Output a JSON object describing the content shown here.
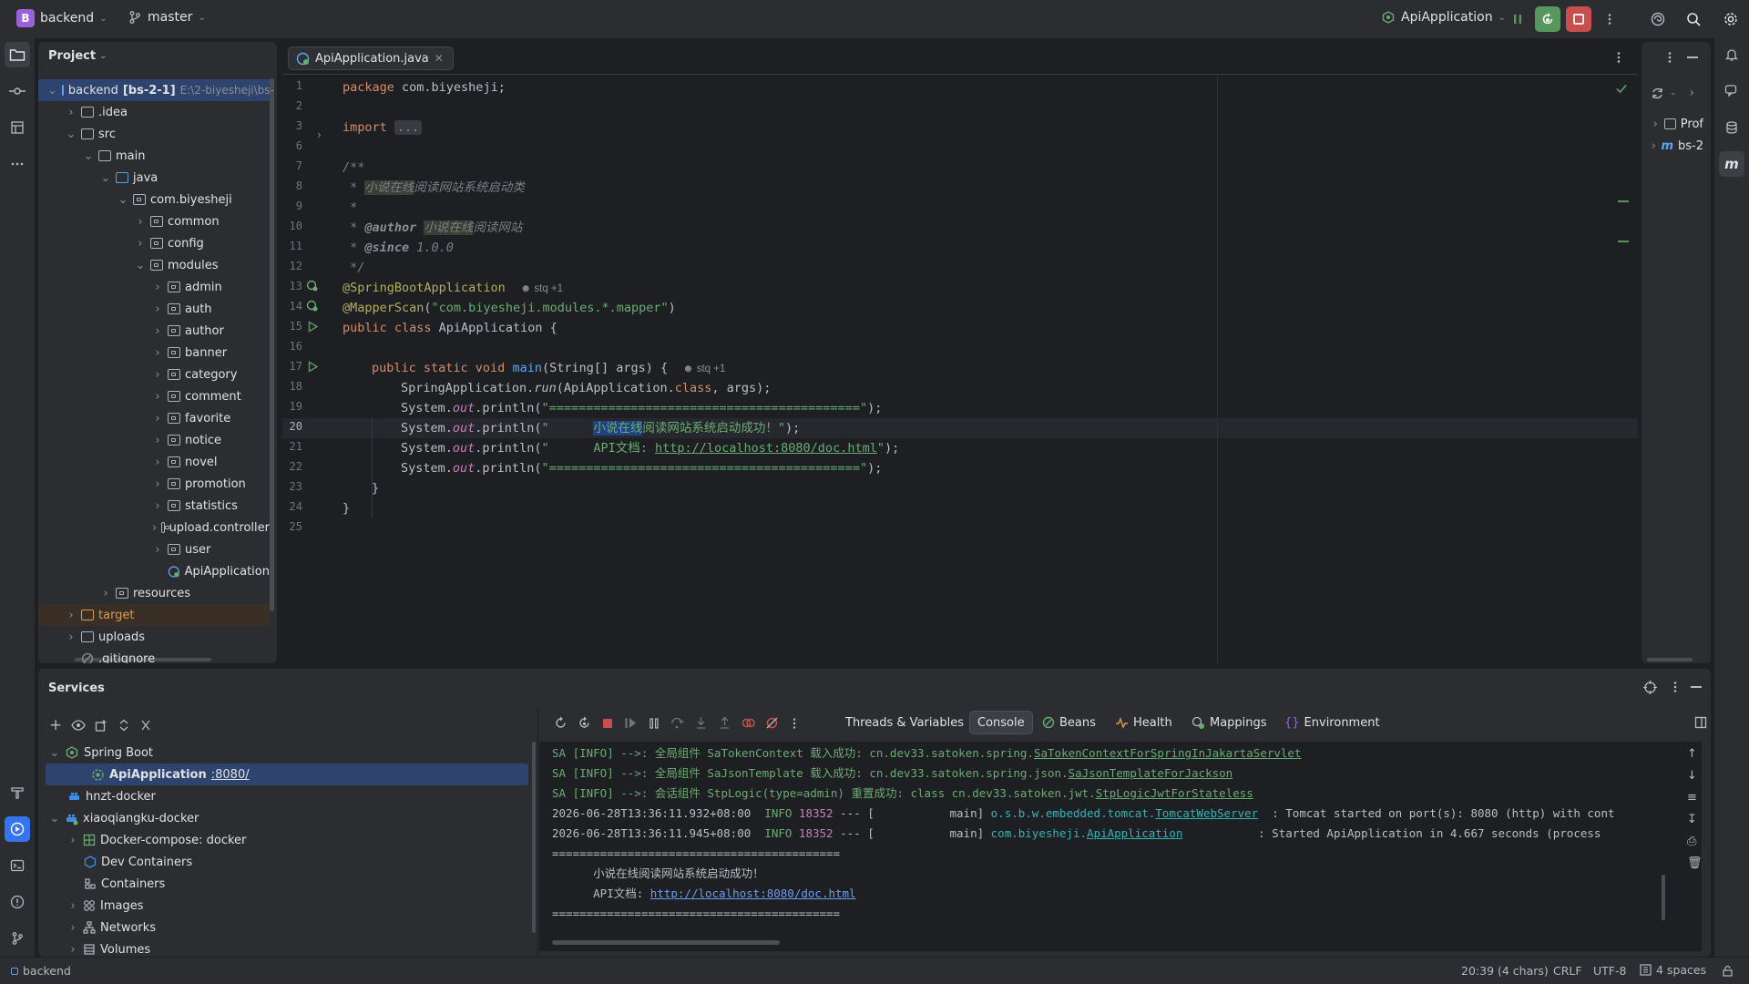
{
  "titlebar": {
    "project_letter": "B",
    "project_name": "backend",
    "branch": "master",
    "run_config": "ApiApplication"
  },
  "project_panel": {
    "title": "Project",
    "root_name": "backend",
    "root_module": "[bs-2-1]",
    "root_path": "E:\\2-biyesheji\\bs-",
    "items": [
      {
        "label": "backend"
      },
      {
        "label": ".idea"
      },
      {
        "label": "src"
      },
      {
        "label": "main"
      },
      {
        "label": "java"
      },
      {
        "label": "com.biyesheji"
      },
      {
        "label": "common"
      },
      {
        "label": "config"
      },
      {
        "label": "modules"
      },
      {
        "label": "admin"
      },
      {
        "label": "auth"
      },
      {
        "label": "author"
      },
      {
        "label": "banner"
      },
      {
        "label": "category"
      },
      {
        "label": "comment"
      },
      {
        "label": "favorite"
      },
      {
        "label": "notice"
      },
      {
        "label": "novel"
      },
      {
        "label": "promotion"
      },
      {
        "label": "statistics"
      },
      {
        "label": "upload.controller"
      },
      {
        "label": "user"
      },
      {
        "label": "ApiApplication"
      },
      {
        "label": "resources"
      },
      {
        "label": "target"
      },
      {
        "label": "uploads"
      },
      {
        "label": ".gitignore"
      }
    ]
  },
  "editor": {
    "tab_label": "ApiApplication.java",
    "line_numbers": [
      "1",
      "2",
      "3",
      "6",
      "7",
      "8",
      "9",
      "10",
      "11",
      "12",
      "13",
      "14",
      "15",
      "16",
      "17",
      "18",
      "19",
      "20",
      "21",
      "22",
      "23",
      "24",
      "25"
    ],
    "code": {
      "l1_kw": "package",
      "l1_rest": " com.biyesheji;",
      "l3_kw": "import",
      "l3_fold": "...",
      "l7": "/**",
      "l8_star": " * ",
      "l8_hl": "小说在线",
      "l8_rest": "阅读网站系统启动类",
      "l9": " *",
      "l10_star": " * ",
      "l10_tag": "@author",
      "l10_hl": "小说在线",
      "l10_rest": "阅读网站",
      "l11_star": " * ",
      "l11_tag": "@since",
      "l11_rest": " 1.0.0",
      "l12": " */",
      "l13_ann": "@SpringBootApplication",
      "l13_inlay": "stq +1",
      "l14_ann": "@MapperScan",
      "l14_open": "(",
      "l14_str": "\"com.biyesheji.modules.*.mapper\"",
      "l14_close": ")",
      "l15_kw": "public class",
      "l15_rest": " ApiApplication {",
      "l17_kw": "public static void",
      "l17_fn": "main",
      "l17_rest": "(String[] args) {",
      "l17_inlay": "stq +1",
      "l18_a": "SpringApplication.",
      "l18_it": "run",
      "l18_b": "(ApiApplication.",
      "l18_kw": "class",
      "l18_c": ", args);",
      "l19_a": "System.",
      "l19_it": "out",
      "l19_b": ".println(",
      "l19_str": "\"==========================================\"",
      "l19_c": ");",
      "l20_a": "System.",
      "l20_it": "out",
      "l20_b": ".println(",
      "l20_str1": "\"      ",
      "l20_sel": "小说在线",
      "l20_str2": "阅读网站系统启动成功！\"",
      "l20_c": ");",
      "l21_a": "System.",
      "l21_it": "out",
      "l21_b": ".println(",
      "l21_str1": "\"      API文档: ",
      "l21_link": "http://localhost:8080/doc.html",
      "l21_str2": "\"",
      "l21_c": ");",
      "l22_a": "System.",
      "l22_it": "out",
      "l22_b": ".println(",
      "l22_str": "\"==========================================\"",
      "l22_c": ");",
      "l23": "}",
      "l24": "}"
    }
  },
  "structure_panel": {
    "items": [
      {
        "label": "Prof"
      },
      {
        "label": "bs-2"
      }
    ]
  },
  "services": {
    "title": "Services",
    "tree": [
      {
        "label": "Spring Boot"
      },
      {
        "label": "ApiApplication",
        "port": ":8080/"
      },
      {
        "label": "hnzt-docker"
      },
      {
        "label": "xiaoqiangku-docker"
      },
      {
        "label": "Docker-compose: docker"
      },
      {
        "label": "Dev Containers"
      },
      {
        "label": "Containers"
      },
      {
        "label": "Images"
      },
      {
        "label": "Networks"
      },
      {
        "label": "Volumes"
      }
    ],
    "tabs": [
      {
        "label": "Threads & Variables"
      },
      {
        "label": "Console"
      },
      {
        "label": "Beans"
      },
      {
        "label": "Health"
      },
      {
        "label": "Mappings"
      },
      {
        "label": "Environment"
      }
    ],
    "console": {
      "c1_a": "SA [INFO] -->: 全局组件 SaTokenContext 载入成功: cn.dev33.satoken.spring.",
      "c1_u": "SaTokenContextForSpringInJakartaServlet",
      "c2_a": "SA [INFO] -->: 全局组件 SaJsonTemplate 载入成功: cn.dev33.satoken.spring.json.",
      "c2_u": "SaJsonTemplateForJackson",
      "c3_a": "SA [INFO] -->: 会话组件 StpLogic(type=admin) 重置成功: class cn.dev33.satoken.jwt.",
      "c3_u": "StpLogicJwtForStateless",
      "c4_a": "2026-06-28T13:36:11.932+08:00  ",
      "c4_info": "INFO",
      "c4_pid": " 18352",
      "c4_b": " --- [           main] ",
      "c4_cls": "o.s.b.w.embedded.tomcat.",
      "c4_u": "TomcatWebServer",
      "c4_msg": "  : Tomcat started on port(s): 8080 (http) with cont",
      "c5_a": "2026-06-28T13:36:11.945+08:00  ",
      "c5_info": "INFO",
      "c5_pid": " 18352",
      "c5_b": " --- [           main] ",
      "c5_cls": "com.biyesheji.",
      "c5_u": "ApiApplication",
      "c5_msg": "           : Started ApiApplication in 4.667 seconds (process",
      "c6": "==========================================",
      "c7": "      小说在线阅读网站系统启动成功！",
      "c8_a": "      API文档: ",
      "c8_link": "http://localhost:8080/doc.html",
      "c9": "=========================================="
    }
  },
  "statusbar": {
    "module": "backend",
    "position": "20:39 (4 chars)",
    "line_sep": "CRLF",
    "encoding": "UTF-8",
    "indent": "4 spaces"
  },
  "colors": {
    "accent_blue": "#3574f0",
    "run_green": "#57965c",
    "stop_red": "#c94f4f"
  }
}
